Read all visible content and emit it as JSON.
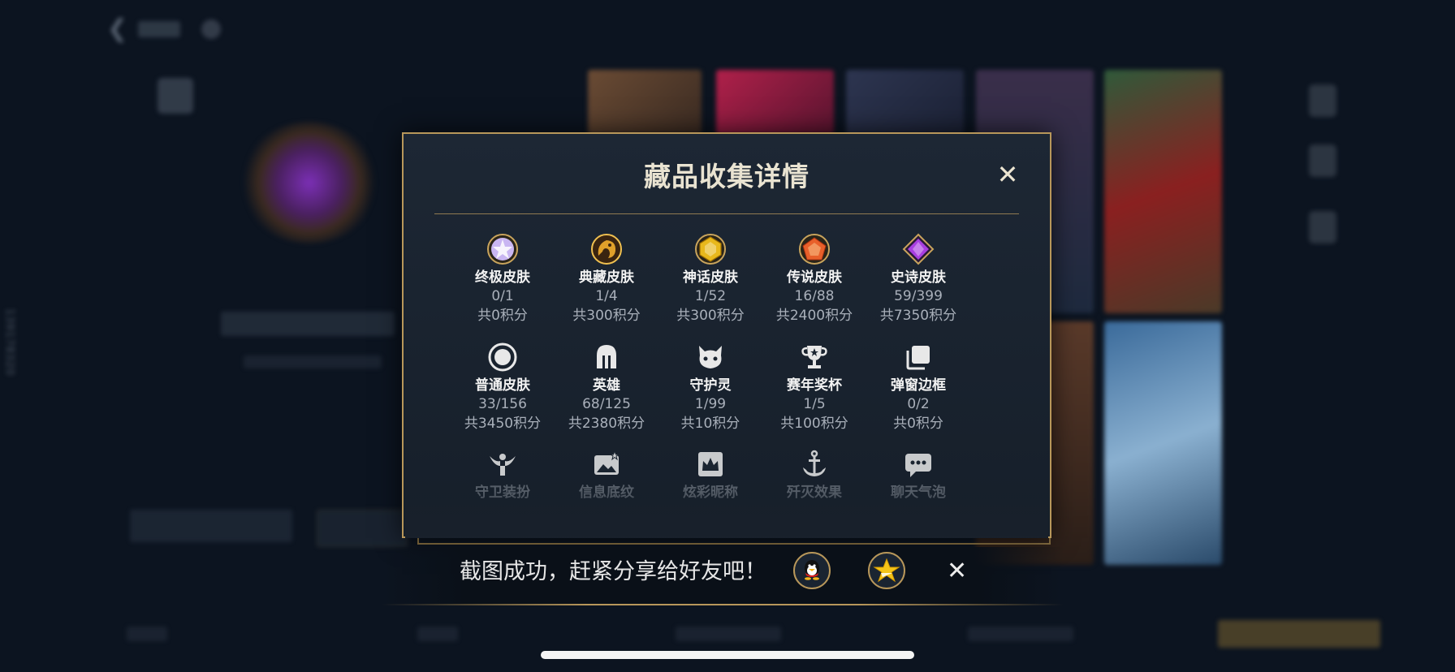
{
  "background": {
    "vertical_id": "139178320"
  },
  "modal": {
    "title": "藏品收集详情",
    "close_label": "✕",
    "rows": [
      [
        {
          "icon": "ultimate-skin-icon",
          "name": "终极皮肤",
          "count": "0/1",
          "points": "共0积分",
          "color": "#c9b6f2"
        },
        {
          "icon": "collection-skin-icon",
          "name": "典藏皮肤",
          "count": "1/4",
          "points": "共300积分",
          "color": "#e0a02a"
        },
        {
          "icon": "mythic-skin-icon",
          "name": "神话皮肤",
          "count": "1/52",
          "points": "共300积分",
          "color": "#e8b81c"
        },
        {
          "icon": "legend-skin-icon",
          "name": "传说皮肤",
          "count": "16/88",
          "points": "共2400积分",
          "color": "#e8602a"
        },
        {
          "icon": "epic-skin-icon",
          "name": "史诗皮肤",
          "count": "59/399",
          "points": "共7350积分",
          "color": "#a93ee0"
        }
      ],
      [
        {
          "icon": "normal-skin-icon",
          "name": "普通皮肤",
          "count": "33/156",
          "points": "共3450积分",
          "color": "#e8e8e8"
        },
        {
          "icon": "hero-helmet-icon",
          "name": "英雄",
          "count": "68/125",
          "points": "共2380积分",
          "color": "#e8e8e8"
        },
        {
          "icon": "guardian-spirit-icon",
          "name": "守护灵",
          "count": "1/99",
          "points": "共10积分",
          "color": "#e8e8e8"
        },
        {
          "icon": "season-trophy-icon",
          "name": "赛年奖杯",
          "count": "1/5",
          "points": "共100积分",
          "color": "#e8e8e8"
        },
        {
          "icon": "popup-frame-icon",
          "name": "弹窗边框",
          "count": "0/2",
          "points": "共0积分",
          "color": "#e8e8e8"
        }
      ],
      [
        {
          "icon": "guard-outfit-icon",
          "name": "守卫装扮",
          "color": "#e8e8e8"
        },
        {
          "icon": "info-texture-icon",
          "name": "信息底纹",
          "color": "#e8e8e8"
        },
        {
          "icon": "colorful-nickname-icon",
          "name": "炫彩昵称",
          "color": "#e8e8e8"
        },
        {
          "icon": "annihilation-effect-icon",
          "name": "歼灭效果",
          "color": "#e8e8e8"
        },
        {
          "icon": "chat-bubble-icon",
          "name": "聊天气泡",
          "color": "#e8e8e8"
        }
      ]
    ]
  },
  "share": {
    "message": "截图成功，赶紧分享给好友吧！",
    "close_label": "✕",
    "targets": [
      "qq-icon",
      "qzone-star-icon"
    ]
  },
  "colors": {
    "gold_border": "#b8975a",
    "modal_bg": "#1b2531"
  }
}
